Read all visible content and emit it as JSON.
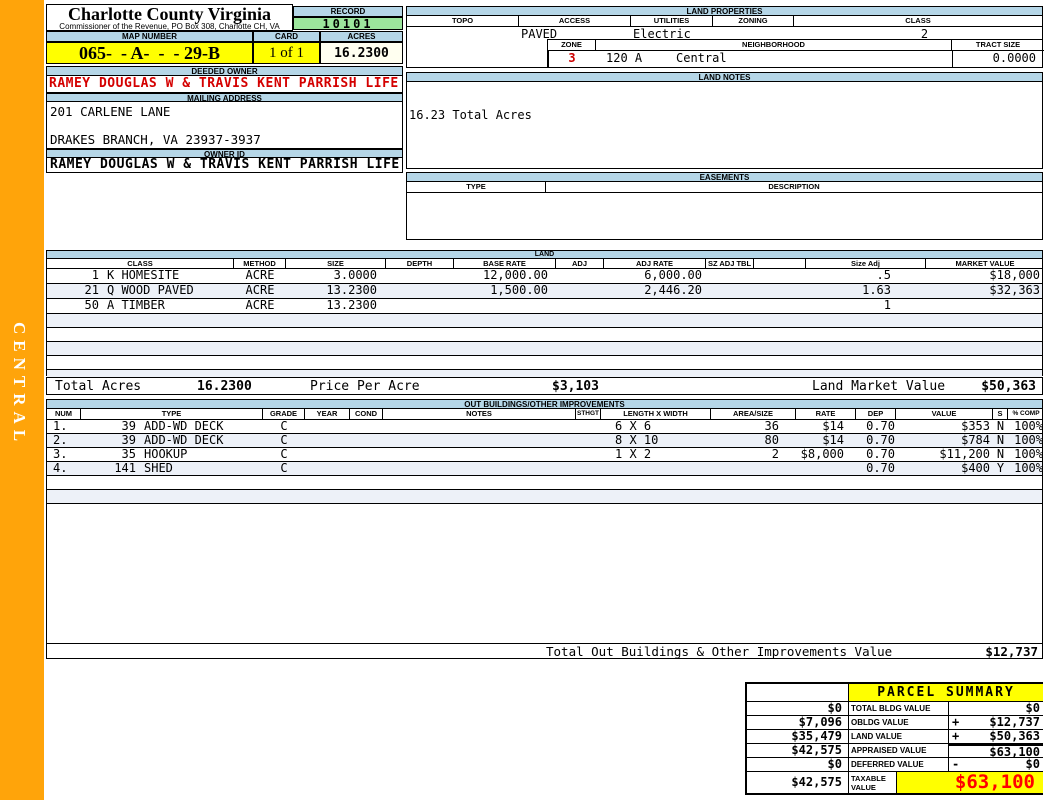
{
  "sidebar": {
    "district": "CENTRAL"
  },
  "header": {
    "county_title": "Charlotte County Virginia",
    "county_subtitle": "Commissioner of the Revenue, PO Box 308, Charlotte CH, VA",
    "record_label": "RECORD",
    "record_value": "10101",
    "map_number_label": "MAP NUMBER",
    "map_number": "065-  - A-  -  - 29-B",
    "card_label": "CARD",
    "card_value": "1 of 1",
    "acres_label": "ACRES",
    "acres_value": "16.2300"
  },
  "owner": {
    "deeded_owner_label": "DEEDED OWNER",
    "deeded_owner": "RAMEY DOUGLAS W & TRAVIS KENT PARRISH LIFE",
    "mailing_address_label": "MAILING ADDRESS",
    "address_line1": "201 CARLENE LANE",
    "address_line2": "DRAKES BRANCH, VA 23937-3937",
    "owner_id_label": "OWNER ID",
    "owner_id": "RAMEY DOUGLAS W & TRAVIS KENT PARRISH LIFE"
  },
  "land_properties": {
    "title": "LAND PROPERTIES",
    "topo_label": "TOPO",
    "access_label": "ACCESS",
    "utilities_label": "UTILITIES",
    "zoning_label": "ZONING",
    "class_label": "CLASS",
    "topo": "",
    "access": "PAVED",
    "utilities": "Electric",
    "zoning": "",
    "class": "2",
    "zone_label": "ZONE",
    "zone": "3",
    "neighborhood_label": "NEIGHBORHOOD",
    "neighborhood_code": "120 A",
    "neighborhood_name": "Central",
    "tract_size_label": "TRACT SIZE",
    "tract_size": "0.0000"
  },
  "land_notes": {
    "title": "LAND NOTES",
    "note": "16.23 Total Acres"
  },
  "easements": {
    "title": "EASEMENTS",
    "type_label": "TYPE",
    "description_label": "DESCRIPTION"
  },
  "land": {
    "title": "LAND",
    "headers": {
      "class": "CLASS",
      "method": "METHOD",
      "size": "SIZE",
      "depth": "DEPTH",
      "base_rate": "BASE RATE",
      "adj": "ADJ",
      "adj_rate": "ADJ RATE",
      "sz_adj_tbl": "SZ ADJ TBL",
      "size_adj": "Size Adj",
      "market_value": "MARKET VALUE"
    },
    "rows": [
      {
        "num": "1",
        "class": "K HOMESITE",
        "method": "ACRE",
        "size": "3.0000",
        "depth": "",
        "base_rate": "12,000.00",
        "adj": "",
        "adj_rate": "6,000.00",
        "sz_adj_tbl": "",
        "size_adj": ".5",
        "market_value": "$18,000"
      },
      {
        "num": "21",
        "class": "Q WOOD PAVED",
        "method": "ACRE",
        "size": "13.2300",
        "depth": "",
        "base_rate": "1,500.00",
        "adj": "",
        "adj_rate": "2,446.20",
        "sz_adj_tbl": "",
        "size_adj": "1.63",
        "market_value": "$32,363"
      },
      {
        "num": "50",
        "class": "A TIMBER",
        "method": "ACRE",
        "size": "13.2300",
        "depth": "",
        "base_rate": "",
        "adj": "",
        "adj_rate": "",
        "sz_adj_tbl": "",
        "size_adj": "1",
        "market_value": ""
      }
    ],
    "totals": {
      "total_acres_label": "Total Acres",
      "total_acres": "16.2300",
      "price_per_acre_label": "Price Per Acre",
      "price_per_acre": "$3,103",
      "land_market_value_label": "Land Market Value",
      "land_market_value": "$50,363"
    }
  },
  "outbuildings": {
    "title": "OUT BUILDINGS/OTHER IMPROVEMENTS",
    "headers": {
      "num": "NUM",
      "type": "TYPE",
      "grade": "GRADE",
      "year": "YEAR",
      "cond": "COND",
      "notes": "NOTES",
      "sthgt": "STHGT",
      "length_width": "LENGTH X WIDTH",
      "area_size": "AREA/SIZE",
      "rate": "RATE",
      "dep": "DEP",
      "value": "VALUE",
      "s": "S",
      "pct_comp": "% COMP"
    },
    "rows": [
      {
        "num": "1.",
        "type_code": "39",
        "type_name": "ADD-WD DECK",
        "grade": "C",
        "length_width": "6 X 6",
        "area_size": "36",
        "rate": "$14",
        "dep": "0.70",
        "value": "$353",
        "s": "N",
        "pct_comp": "100%"
      },
      {
        "num": "2.",
        "type_code": "39",
        "type_name": "ADD-WD DECK",
        "grade": "C",
        "length_width": "8 X 10",
        "area_size": "80",
        "rate": "$14",
        "dep": "0.70",
        "value": "$784",
        "s": "N",
        "pct_comp": "100%"
      },
      {
        "num": "3.",
        "type_code": "35",
        "type_name": "HOOKUP",
        "grade": "C",
        "length_width": "1 X 2",
        "area_size": "2",
        "rate": "$8,000",
        "dep": "0.70",
        "value": "$11,200",
        "s": "N",
        "pct_comp": "100%"
      },
      {
        "num": "4.",
        "type_code": "141",
        "type_name": "SHED",
        "grade": "C",
        "length_width": "",
        "area_size": "",
        "rate": "",
        "dep": "0.70",
        "value": "$400",
        "s": "Y",
        "pct_comp": "100%"
      }
    ],
    "total_label": "Total Out Buildings & Other Improvements Value",
    "total_value": "$12,737"
  },
  "parcel_summary": {
    "title": "PARCEL SUMMARY",
    "rows": [
      {
        "prior": "$0",
        "label": "TOTAL BLDG VALUE",
        "op": "",
        "value": "$0"
      },
      {
        "prior": "$7,096",
        "label": "OBLDG VALUE",
        "op": "+",
        "value": "$12,737"
      },
      {
        "prior": "$35,479",
        "label": "LAND VALUE",
        "op": "+",
        "value": "$50,363"
      },
      {
        "prior": "$42,575",
        "label": "APPRAISED VALUE",
        "op": "",
        "value": "$63,100"
      },
      {
        "prior": "$0",
        "label": "DEFERRED VALUE",
        "op": "-",
        "value": "$0"
      }
    ],
    "taxable": {
      "prior": "$42,575",
      "label": "TAXABLE VALUE",
      "value": "$63,100"
    }
  },
  "colors": {
    "accent_orange": "#ffa40a",
    "header_blue": "#b5d6e7",
    "highlight_yellow": "#ffff00",
    "record_green": "#9ce69c",
    "acres_cream": "#fffff0",
    "owner_red": "#d40000",
    "taxable_red": "#ff0000",
    "row_stripe": "#edf1f8"
  }
}
